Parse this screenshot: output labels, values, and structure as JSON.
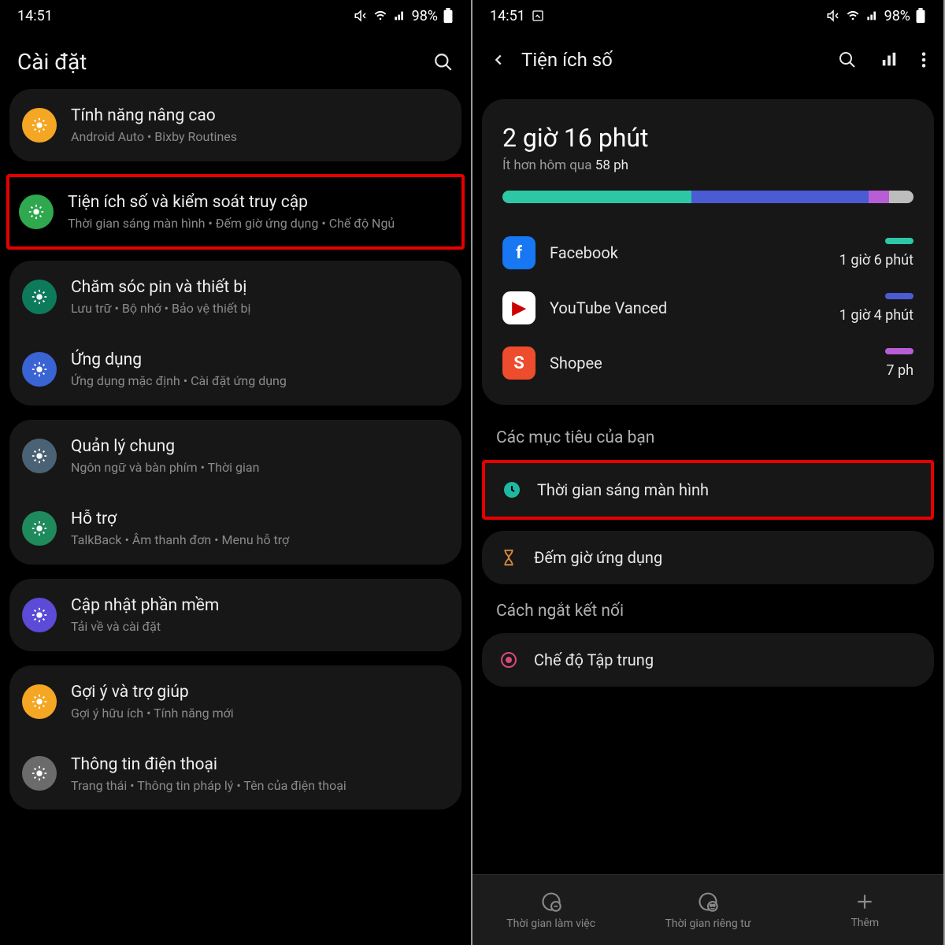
{
  "left": {
    "status": {
      "time": "14:51",
      "battery": "98%"
    },
    "header": {
      "title": "Cài đặt"
    },
    "groups": [
      [
        {
          "icon_bg": "#f5a623",
          "title": "Tính năng nâng cao",
          "sub": "Android Auto  •  Bixby Routines"
        }
      ],
      [
        {
          "icon_bg": "#2fa84f",
          "title": "Tiện ích số và kiểm soát truy cập",
          "sub": "Thời gian sáng màn hình  •  Đếm giờ ứng dụng  •  Chế độ Ngủ",
          "highlight": true
        },
        {
          "icon_bg": "#0e7a5c",
          "title": "Chăm sóc pin và thiết bị",
          "sub": "Lưu trữ  •  Bộ nhớ  •  Bảo vệ thiết bị"
        },
        {
          "icon_bg": "#3a63d4",
          "title": "Ứng dụng",
          "sub": "Ứng dụng mặc định  •  Cài đặt ứng dụng"
        }
      ],
      [
        {
          "icon_bg": "#4a6273",
          "title": "Quản lý chung",
          "sub": "Ngôn ngữ và bàn phím  •  Thời gian"
        },
        {
          "icon_bg": "#1f8a5b",
          "title": "Hỗ trợ",
          "sub": "TalkBack  •  Âm thanh đơn  •  Menu hỗ trợ"
        }
      ],
      [
        {
          "icon_bg": "#5b4bd6",
          "title": "Cập nhật phần mềm",
          "sub": "Tải về và cài đặt"
        }
      ],
      [
        {
          "icon_bg": "#f5a623",
          "title": "Gợi ý và trợ giúp",
          "sub": "Gợi ý hữu ích  •  Tính năng mới"
        },
        {
          "icon_bg": "#6b6b6b",
          "title": "Thông tin điện thoại",
          "sub": "Trang thái  •  Thông tin pháp lý  •  Tên của điện thoại"
        }
      ]
    ]
  },
  "right": {
    "status": {
      "time": "14:51",
      "battery": "98%"
    },
    "header": {
      "title": "Tiện ích số"
    },
    "usage": {
      "total": "2 giờ 16 phút",
      "sub_prefix": "Ít hơn hôm qua ",
      "sub_bold": "58 ph",
      "segments": [
        {
          "color": "#2ec7a6",
          "pct": 46
        },
        {
          "color": "#4a5bd4",
          "pct": 43
        },
        {
          "color": "#b95dd6",
          "pct": 5
        },
        {
          "color": "#bdbdbd",
          "pct": 6
        }
      ],
      "apps": [
        {
          "name": "Facebook",
          "time": "1 giờ 6 phút",
          "color": "#2ec7a6",
          "icon_bg": "#1877f2",
          "letter": "f"
        },
        {
          "name": "YouTube Vanced",
          "time": "1 giờ 4 phút",
          "color": "#4a5bd4",
          "icon_bg": "#fff",
          "letter": "▶"
        },
        {
          "name": "Shopee",
          "time": "7 ph",
          "color": "#b95dd6",
          "icon_bg": "#ee4d2d",
          "letter": "S"
        }
      ]
    },
    "goals_heading": "Các mục tiêu của bạn",
    "goals": [
      {
        "label": "Thời gian sáng màn hình",
        "highlight": true,
        "icon_color": "#1fb9a1"
      },
      {
        "label": "Đếm giờ ứng dụng",
        "highlight": false,
        "icon_color": "#d68c3a"
      }
    ],
    "disconnect_heading": "Cách ngắt kết nối",
    "focus_label": "Chế độ Tập trung",
    "tabs": [
      {
        "label": "Thời gian làm việc"
      },
      {
        "label": "Thời gian riêng tư"
      },
      {
        "label": "Thêm"
      }
    ]
  }
}
